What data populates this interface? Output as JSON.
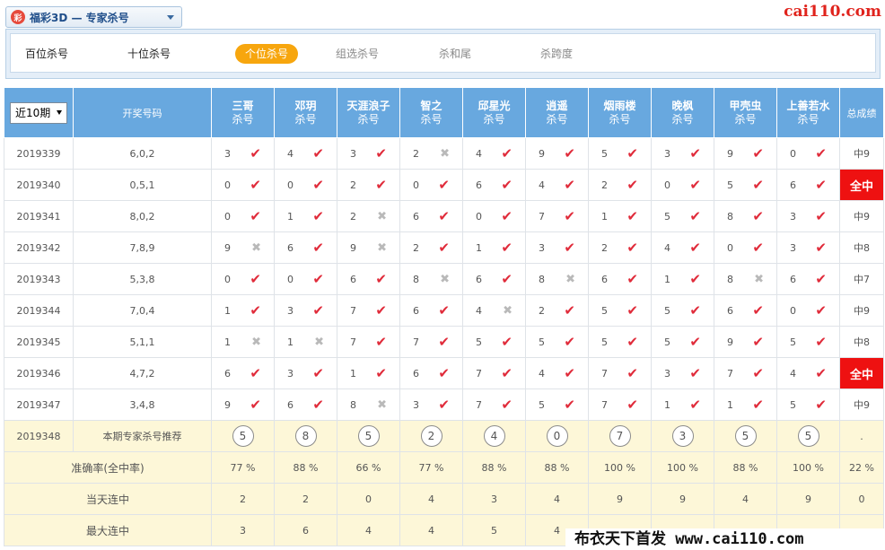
{
  "lottery": {
    "logo": "彩",
    "label": "福彩3D — 专家杀号"
  },
  "site": {
    "logo_text": "cai110.com"
  },
  "tabs": [
    {
      "label": "百位杀号",
      "state": "dark"
    },
    {
      "label": "十位杀号",
      "state": "dark"
    },
    {
      "label": "个位杀号",
      "state": "active"
    },
    {
      "label": "组选杀号",
      "state": "muted"
    },
    {
      "label": "杀和尾",
      "state": "muted"
    },
    {
      "label": "杀跨度",
      "state": "muted"
    }
  ],
  "table": {
    "period_select": "近10期",
    "draw_header": "开奖号码",
    "score_header": "总成绩",
    "sub_label": "杀号",
    "experts": [
      "三哥",
      "邓玥",
      "天涯浪子",
      "智之",
      "邱星光",
      "逍遥",
      "烟雨楼",
      "晚枫",
      "甲壳虫",
      "上善若水"
    ],
    "rows": [
      {
        "issue": "2019339",
        "draw": "6,0,2",
        "cells": [
          [
            "3",
            "y"
          ],
          [
            "4",
            "y"
          ],
          [
            "3",
            "y"
          ],
          [
            "2",
            "n"
          ],
          [
            "4",
            "y"
          ],
          [
            "9",
            "y"
          ],
          [
            "5",
            "y"
          ],
          [
            "3",
            "y"
          ],
          [
            "9",
            "y"
          ],
          [
            "0",
            "y"
          ]
        ],
        "score": "中9",
        "full": false
      },
      {
        "issue": "2019340",
        "draw": "0,5,1",
        "cells": [
          [
            "0",
            "y"
          ],
          [
            "0",
            "y"
          ],
          [
            "2",
            "y"
          ],
          [
            "0",
            "y"
          ],
          [
            "6",
            "y"
          ],
          [
            "4",
            "y"
          ],
          [
            "2",
            "y"
          ],
          [
            "0",
            "y"
          ],
          [
            "5",
            "y"
          ],
          [
            "6",
            "y"
          ]
        ],
        "score": "全中",
        "full": true
      },
      {
        "issue": "2019341",
        "draw": "8,0,2",
        "cells": [
          [
            "0",
            "y"
          ],
          [
            "1",
            "y"
          ],
          [
            "2",
            "n"
          ],
          [
            "6",
            "y"
          ],
          [
            "0",
            "y"
          ],
          [
            "7",
            "y"
          ],
          [
            "1",
            "y"
          ],
          [
            "5",
            "y"
          ],
          [
            "8",
            "y"
          ],
          [
            "3",
            "y"
          ]
        ],
        "score": "中9",
        "full": false
      },
      {
        "issue": "2019342",
        "draw": "7,8,9",
        "cells": [
          [
            "9",
            "n"
          ],
          [
            "6",
            "y"
          ],
          [
            "9",
            "n"
          ],
          [
            "2",
            "y"
          ],
          [
            "1",
            "y"
          ],
          [
            "3",
            "y"
          ],
          [
            "2",
            "y"
          ],
          [
            "4",
            "y"
          ],
          [
            "0",
            "y"
          ],
          [
            "3",
            "y"
          ]
        ],
        "score": "中8",
        "full": false
      },
      {
        "issue": "2019343",
        "draw": "5,3,8",
        "cells": [
          [
            "0",
            "y"
          ],
          [
            "0",
            "y"
          ],
          [
            "6",
            "y"
          ],
          [
            "8",
            "n"
          ],
          [
            "6",
            "y"
          ],
          [
            "8",
            "n"
          ],
          [
            "6",
            "y"
          ],
          [
            "1",
            "y"
          ],
          [
            "8",
            "n"
          ],
          [
            "6",
            "y"
          ]
        ],
        "score": "中7",
        "full": false
      },
      {
        "issue": "2019344",
        "draw": "7,0,4",
        "cells": [
          [
            "1",
            "y"
          ],
          [
            "3",
            "y"
          ],
          [
            "7",
            "y"
          ],
          [
            "6",
            "y"
          ],
          [
            "4",
            "n"
          ],
          [
            "2",
            "y"
          ],
          [
            "5",
            "y"
          ],
          [
            "5",
            "y"
          ],
          [
            "6",
            "y"
          ],
          [
            "0",
            "y"
          ]
        ],
        "score": "中9",
        "full": false
      },
      {
        "issue": "2019345",
        "draw": "5,1,1",
        "cells": [
          [
            "1",
            "n"
          ],
          [
            "1",
            "n"
          ],
          [
            "7",
            "y"
          ],
          [
            "7",
            "y"
          ],
          [
            "5",
            "y"
          ],
          [
            "5",
            "y"
          ],
          [
            "5",
            "y"
          ],
          [
            "5",
            "y"
          ],
          [
            "9",
            "y"
          ],
          [
            "5",
            "y"
          ]
        ],
        "score": "中8",
        "full": false
      },
      {
        "issue": "2019346",
        "draw": "4,7,2",
        "cells": [
          [
            "6",
            "y"
          ],
          [
            "3",
            "y"
          ],
          [
            "1",
            "y"
          ],
          [
            "6",
            "y"
          ],
          [
            "7",
            "y"
          ],
          [
            "4",
            "y"
          ],
          [
            "7",
            "y"
          ],
          [
            "3",
            "y"
          ],
          [
            "7",
            "y"
          ],
          [
            "4",
            "y"
          ]
        ],
        "score": "全中",
        "full": true
      },
      {
        "issue": "2019347",
        "draw": "3,4,8",
        "cells": [
          [
            "9",
            "y"
          ],
          [
            "6",
            "y"
          ],
          [
            "8",
            "n"
          ],
          [
            "3",
            "y"
          ],
          [
            "7",
            "y"
          ],
          [
            "5",
            "y"
          ],
          [
            "7",
            "y"
          ],
          [
            "1",
            "y"
          ],
          [
            "1",
            "y"
          ],
          [
            "5",
            "y"
          ]
        ],
        "score": "中9",
        "full": false
      }
    ],
    "recommend": {
      "issue": "2019348",
      "label": "本期专家杀号推荐",
      "numbers": [
        "5",
        "8",
        "5",
        "2",
        "4",
        "0",
        "7",
        "3",
        "5",
        "5"
      ],
      "score": "."
    },
    "accuracy": {
      "label": "准确率(全中率)",
      "values": [
        "77 %",
        "88 %",
        "66 %",
        "77 %",
        "88 %",
        "88 %",
        "100 %",
        "100 %",
        "88 %",
        "100 %"
      ],
      "score": "22 %"
    },
    "current_streak": {
      "label": "当天连中",
      "values": [
        "2",
        "2",
        "0",
        "4",
        "3",
        "4",
        "9",
        "9",
        "4",
        "9"
      ],
      "score": "0"
    },
    "max_streak": {
      "label": "最大连中",
      "values": [
        "3",
        "6",
        "4",
        "4",
        "5",
        "4",
        "",
        "",
        "",
        ""
      ],
      "score": ""
    }
  },
  "watermark": "布衣天下首发 www.cai110.com",
  "colors": {
    "header": "#68a8df",
    "accent": "#f7a60e",
    "hit": "#e02b3a",
    "full_hit": "#ee1111",
    "recommend_bg": "#fdf7d8"
  }
}
